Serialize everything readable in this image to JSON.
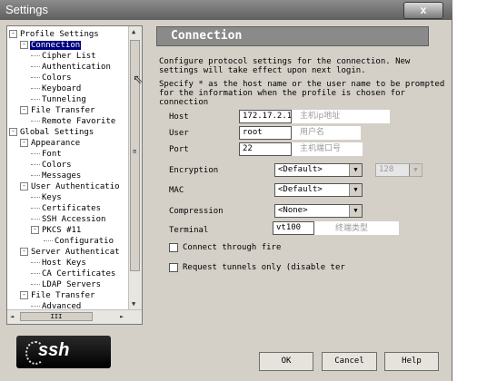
{
  "window": {
    "title": "Settings",
    "close_label": "x"
  },
  "tree": {
    "items": [
      {
        "label": "Profile Settings",
        "expander": "-"
      },
      {
        "label": "Connection",
        "expander": "-"
      },
      {
        "label": "Cipher List",
        "expander": ""
      },
      {
        "label": "Authentication",
        "expander": ""
      },
      {
        "label": "Colors",
        "expander": ""
      },
      {
        "label": "Keyboard",
        "expander": ""
      },
      {
        "label": "Tunneling",
        "expander": ""
      },
      {
        "label": "File Transfer",
        "expander": "-"
      },
      {
        "label": "Remote Favorite",
        "expander": ""
      },
      {
        "label": "Global Settings",
        "expander": "-"
      },
      {
        "label": "Appearance",
        "expander": "-"
      },
      {
        "label": "Font",
        "expander": ""
      },
      {
        "label": "Colors",
        "expander": ""
      },
      {
        "label": "Messages",
        "expander": ""
      },
      {
        "label": "User Authenticatio",
        "expander": "-"
      },
      {
        "label": "Keys",
        "expander": ""
      },
      {
        "label": "Certificates",
        "expander": ""
      },
      {
        "label": "SSH Accession",
        "expander": ""
      },
      {
        "label": "PKCS #11",
        "expander": "-"
      },
      {
        "label": "Configuratio",
        "expander": ""
      },
      {
        "label": "Server Authenticat",
        "expander": "-"
      },
      {
        "label": "Host Keys",
        "expander": ""
      },
      {
        "label": "CA Certificates",
        "expander": ""
      },
      {
        "label": "LDAP Servers",
        "expander": ""
      },
      {
        "label": "File Transfer",
        "expander": "-"
      },
      {
        "label": "Advanced",
        "expander": ""
      }
    ],
    "scroll_up": "▲",
    "scroll_down": "▼",
    "scroll_left": "◄",
    "scroll_right": "►",
    "scroll_mid": "≡",
    "hthumb_label": "III"
  },
  "logo": {
    "text": "ssh"
  },
  "panel": {
    "header": "Connection",
    "desc1": "Configure protocol settings for the connection. New\nsettings will take effect upon next login.",
    "desc2": "Specify * as the host name or the user name to be prompted\nfor the information when the profile is chosen for\nconnection",
    "fields": {
      "host": {
        "label": "Host",
        "value": "172.17.2.1",
        "hint": "主机ip地址"
      },
      "user": {
        "label": "User",
        "value": "root",
        "hint": "用户名"
      },
      "port": {
        "label": "Port",
        "value": "22",
        "hint": "主机端口号"
      },
      "encryption": {
        "label": "Encryption",
        "value": "<Default>",
        "keylen": "128"
      },
      "mac": {
        "label": "MAC",
        "value": "<Default>"
      },
      "compression": {
        "label": "Compression",
        "value": "<None>"
      },
      "terminal": {
        "label": "Terminal",
        "value": "vt100",
        "hint": "终端类型"
      }
    },
    "checks": {
      "firewall": "Connect through fire",
      "tunnels": "Request tunnels only (disable ter"
    }
  },
  "buttons": {
    "ok": "OK",
    "cancel": "Cancel",
    "help": "Help"
  },
  "dropdown_glyph": "▼"
}
